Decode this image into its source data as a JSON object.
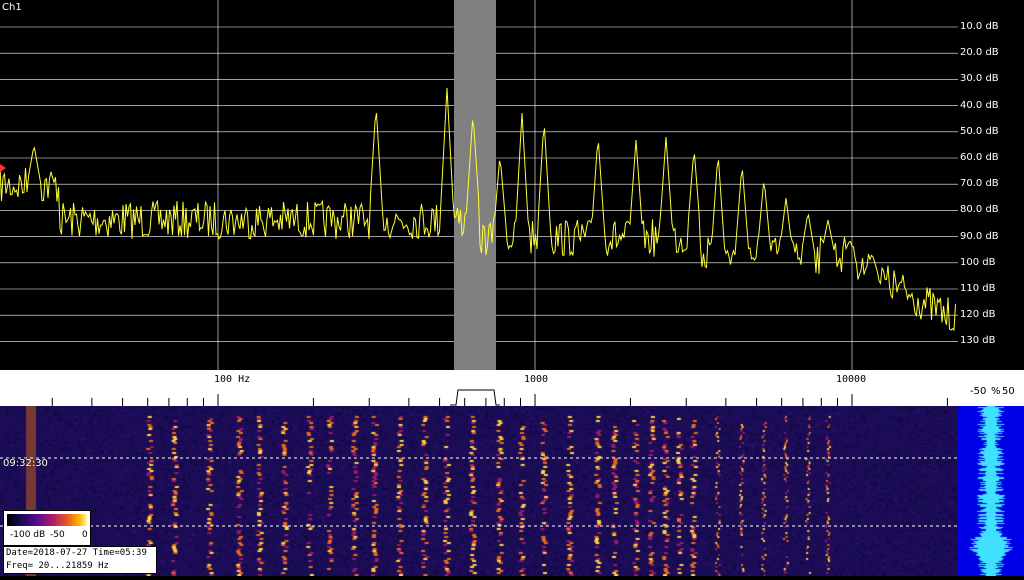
{
  "channel_label": "Ch1",
  "db_scale": [
    "10.0 dB",
    "20.0 dB",
    "30.0 dB",
    "40.0 dB",
    "50.0 dB",
    "60.0 dB",
    "70.0 dB",
    "80.0 dB",
    "90.0 dB",
    "100 dB",
    "110 dB",
    "120 dB",
    "130 dB"
  ],
  "freq_axis_labels": [
    "100 Hz",
    "1000",
    "10000"
  ],
  "scope_labels": {
    "left": "-50",
    "mid": "%",
    "right": "50"
  },
  "waterfall": {
    "time_marker": "09:32:30"
  },
  "colorbar": {
    "min_label": "-100 dB",
    "mid_label": "-50",
    "max_label": "0"
  },
  "info": {
    "line1": "Date=2018-07-27 Time=05:39",
    "line2": "Freq= 20...21859 Hz"
  },
  "colors": {
    "trace": "#ffff33",
    "highlight_band": "#808080",
    "grid": "#ffffff",
    "scope_bg": "#0000e6",
    "scope_wave": "#40e0ff"
  },
  "view": {
    "freq_min_hz": 20,
    "freq_max_hz": 21859,
    "db_top": 0,
    "db_bottom": -135,
    "highlight_band_hz": [
      600,
      800
    ]
  }
}
